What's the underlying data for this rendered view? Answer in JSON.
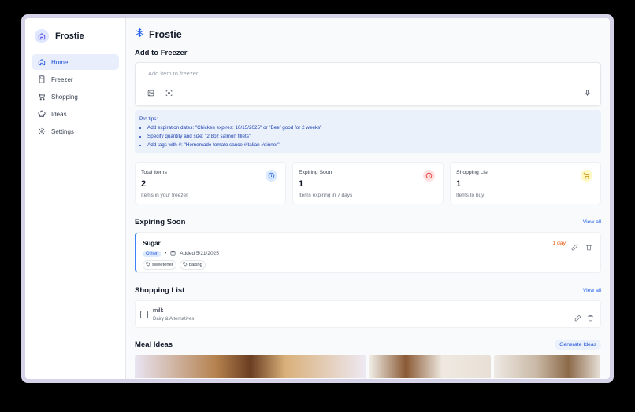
{
  "app": {
    "name": "Frostie"
  },
  "sidebar": {
    "items": [
      {
        "label": "Home",
        "icon": "home-icon",
        "active": true
      },
      {
        "label": "Freezer",
        "icon": "freezer-icon",
        "active": false
      },
      {
        "label": "Shopping",
        "icon": "cart-icon",
        "active": false
      },
      {
        "label": "Ideas",
        "icon": "chef-hat-icon",
        "active": false
      },
      {
        "label": "Settings",
        "icon": "gear-icon",
        "active": false
      }
    ]
  },
  "header": {
    "title": "Frostie",
    "icon": "snowflake-icon"
  },
  "add_section": {
    "title": "Add to Freezer",
    "placeholder": "Add item to freezer...",
    "tips_title": "Pro tips:",
    "tips": [
      "Add expiration dates: \"Chicken expires: 10/15/2025\" or \"Beef good for 2 weeks\"",
      "Specify quantity and size: \"2 8oz salmon fillets\"",
      "Add tags with #: \"Homemade tomato sauce #italian #dinner\""
    ]
  },
  "stats": [
    {
      "label": "Total Items",
      "value": "2",
      "sub": "Items in your freezer",
      "icon": "info-icon",
      "color": "#dbeafe"
    },
    {
      "label": "Expiring Soon",
      "value": "1",
      "sub": "Items expiring in 7 days",
      "icon": "clock-icon",
      "color": "#fee2e2"
    },
    {
      "label": "Shopping List",
      "value": "1",
      "sub": "Items to buy",
      "icon": "cart-icon",
      "color": "#fef9c3"
    }
  ],
  "expiring": {
    "title": "Expiring Soon",
    "view_all": "View all",
    "item": {
      "name": "Sugar",
      "category": "Other",
      "added": "Added 5/21/2025",
      "tags": [
        "sweetener",
        "baking"
      ],
      "days_left": "1 day"
    }
  },
  "shopping": {
    "title": "Shopping List",
    "view_all": "View all",
    "item": {
      "name": "milk",
      "category": "Dairy & Alternatives"
    }
  },
  "meals": {
    "title": "Meal Ideas",
    "button": "Generate Ideas"
  },
  "colors": {
    "accent": "#2563eb",
    "warning": "#ea580c",
    "sidebar_active": "#e8eefb"
  }
}
